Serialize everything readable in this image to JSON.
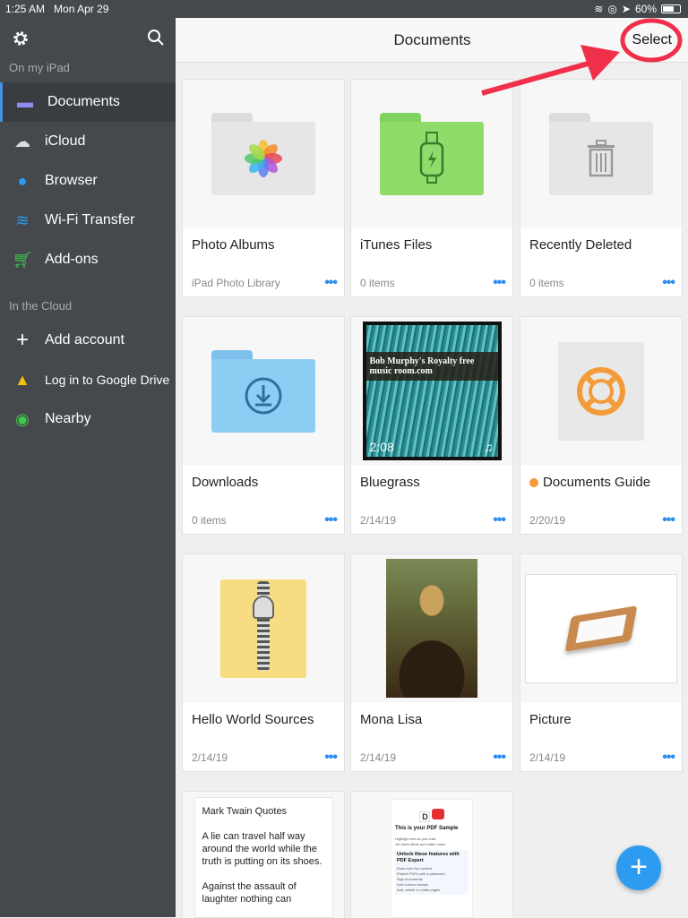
{
  "status": {
    "time": "1:25 AM",
    "date": "Mon Apr 29",
    "battery": "60%",
    "battery_level": 0.6
  },
  "sidebar": {
    "section_local": "On my iPad",
    "items": [
      {
        "label": "Documents",
        "icon": "folder-icon"
      },
      {
        "label": "iCloud",
        "icon": "cloud-icon"
      },
      {
        "label": "Browser",
        "icon": "compass-icon"
      },
      {
        "label": "Wi-Fi Transfer",
        "icon": "wifi-icon"
      },
      {
        "label": "Add-ons",
        "icon": "cart-icon"
      }
    ],
    "section_cloud": "In the Cloud",
    "cloud_items": [
      {
        "label": "Add account",
        "icon": "plus-icon"
      },
      {
        "label": "Log in to Google Drive",
        "icon": "google-drive-icon"
      },
      {
        "label": "Nearby",
        "icon": "nearby-icon"
      }
    ]
  },
  "header": {
    "title": "Documents",
    "select": "Select"
  },
  "cards": [
    {
      "name": "Photo Albums",
      "sub": "iPad Photo Library"
    },
    {
      "name": "iTunes Files",
      "sub": "0 items"
    },
    {
      "name": "Recently Deleted",
      "sub": "0 items"
    },
    {
      "name": "Downloads",
      "sub": "0 items"
    },
    {
      "name": "Bluegrass",
      "sub": "2/14/19",
      "duration": "2:08",
      "thumb_text": "Bob Murphy's Royalty free music room.com"
    },
    {
      "name": "Documents Guide",
      "sub": "2/20/19"
    },
    {
      "name": "Hello World Sources",
      "sub": "2/14/19"
    },
    {
      "name": "Mona Lisa",
      "sub": "2/14/19"
    },
    {
      "name": "Picture",
      "sub": "2/14/19"
    }
  ],
  "quotes": {
    "title": "Mark Twain Quotes",
    "p1": "A lie can travel half way around the world while the truth is putting on its shoes.",
    "p2": "Against the assault of laughter nothing can"
  },
  "pdf": {
    "title": "This is your PDF Sample",
    "b1": "Highlight text as you read",
    "b2": "Jot down ideas and make notes",
    "h2": "Unlock these features with PDF Expert",
    "f": [
      "Draw over the content",
      "Protect PDFs with a password",
      "Sign documents",
      "Add custom stamps",
      "Add, delete or rotate pages"
    ]
  },
  "more": "•••",
  "fab": "+",
  "colors": {
    "accent": "#2d9cf0",
    "sidebar": "#45484d",
    "annotation": "#f0304a"
  }
}
